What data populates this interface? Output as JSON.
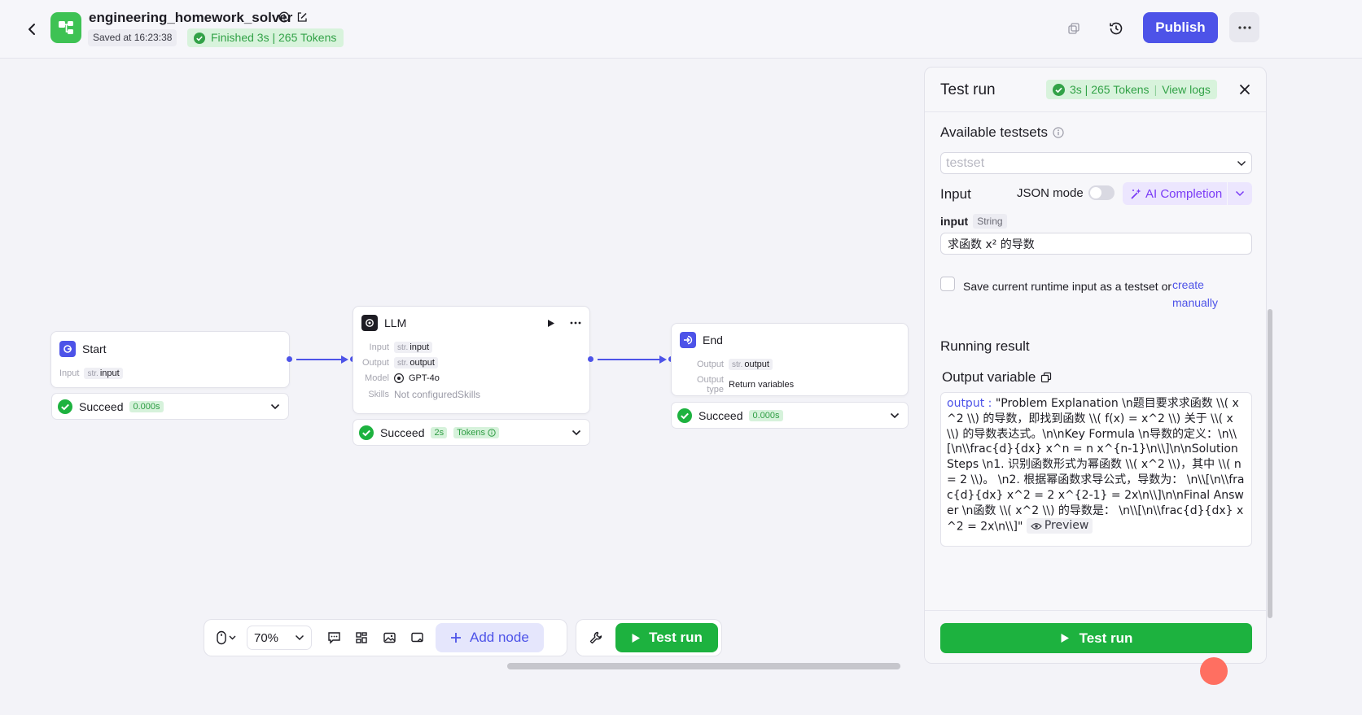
{
  "header": {
    "app_title": "engineering_homework_solver",
    "saved_text": "Saved at 16:23:38",
    "finished_text": "Finished 3s | 265 Tokens",
    "publish_label": "Publish"
  },
  "nodes": {
    "start": {
      "title": "Start",
      "input_label": "Input",
      "input_type": "str.",
      "input_name": "input",
      "status": "Succeed",
      "time": "0.000s"
    },
    "llm": {
      "title": "LLM",
      "input_label": "Input",
      "input_type": "str.",
      "input_name": "input",
      "output_label": "Output",
      "output_type": "str.",
      "output_name": "output",
      "model_label": "Model",
      "model_name": "GPT-4o",
      "skills_label": "Skills",
      "skills_value": "Not configuredSkills",
      "status": "Succeed",
      "time": "2s",
      "tokens_label": "Tokens"
    },
    "end": {
      "title": "End",
      "output_label": "Output",
      "output_type": "str.",
      "output_name": "output",
      "output_type_label": "Output type",
      "output_type_value": "Return variables",
      "status": "Succeed",
      "time": "0.000s"
    }
  },
  "toolbar": {
    "zoom": "70%",
    "add_node_label": "Add node",
    "test_run_label": "Test run"
  },
  "panel": {
    "title": "Test run",
    "run_stats": "3s | 265 Tokens",
    "view_logs": "View logs",
    "available_testsets": "Available testsets",
    "testset_placeholder": "testset",
    "input_section": "Input",
    "json_mode": "JSON mode",
    "ai_completion": "AI Completion",
    "field_name": "input",
    "field_type": "String",
    "field_value": "求函数 x² 的导数",
    "save_text": "Save current runtime input as a testset or",
    "create_manually": "create manually",
    "running_result": "Running result",
    "output_variable": "Output variable",
    "output_key": "output",
    "output_value": "\"Problem Explanation  \\n题目要求求函数 \\\\( x^2 \\\\) 的导数，即找到函数 \\\\( f(x) = x^2 \\\\) 关于 \\\\( x \\\\) 的导数表达式。\\n\\nKey Formula  \\n导数的定义：\\n\\\\[\\n\\\\frac{d}{dx} x^n = n x^{n-1}\\n\\\\]\\n\\nSolution Steps  \\n1. 识别函数形式为幂函数 \\\\( x^2 \\\\)，其中 \\\\( n = 2 \\\\)。  \\n2. 根据幂函数求导公式，导数为：  \\n\\\\[\\n\\\\frac{d}{dx} x^2 = 2 x^{2-1} = 2x\\n\\\\]\\n\\nFinal Answer  \\n函数 \\\\( x^2 \\\\) 的导数是：  \\n\\\\[\\n\\\\frac{d}{dx} x^2 = 2x\\n\\\\]\"",
    "preview": "Preview",
    "test_run_label": "Test run"
  },
  "colors": {
    "primary": "#4d53e8",
    "success": "#1db23f",
    "success_bg": "#d8f3dc",
    "ai": "#7a3bf6"
  }
}
